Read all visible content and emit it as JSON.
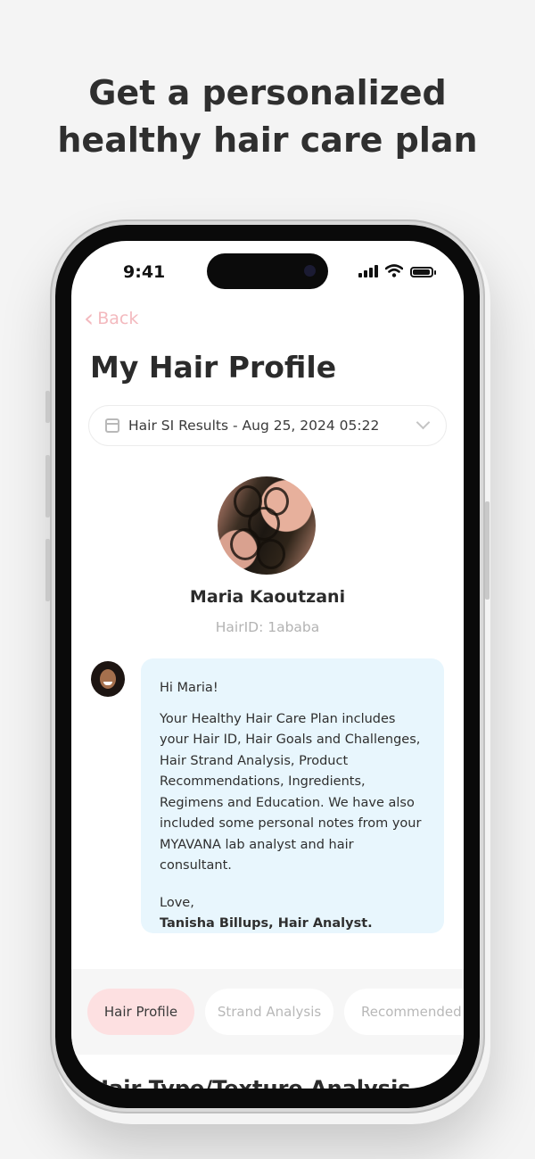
{
  "headline": {
    "line1": "Get a personalized",
    "line2": "healthy hair care plan"
  },
  "status_bar": {
    "time": "9:41"
  },
  "nav": {
    "back_label": "Back"
  },
  "page": {
    "title": "My Hair Profile"
  },
  "results_dropdown": {
    "selected": "Hair SI Results - Aug 25, 2024 05:22"
  },
  "profile": {
    "name": "Maria Kaoutzani",
    "hair_id": "HairID: 1ababa"
  },
  "message": {
    "greeting": "Hi Maria!",
    "body": "Your Healthy Hair Care Plan includes your Hair ID, Hair Goals and Challenges, Hair Strand Analysis, Product Recommendations, Ingredients, Regimens and Education. We have also included some personal notes from your MYAVANA lab analyst and hair consultant.",
    "closing": "Love,",
    "signature": "Tanisha Billups, Hair Analyst."
  },
  "tabs": [
    {
      "label": "Hair Profile",
      "active": true
    },
    {
      "label": "Strand Analysis",
      "active": false
    },
    {
      "label": "Recommended P",
      "active": false
    }
  ],
  "section": {
    "title_peek": "Hair Type/Texture Analysis"
  },
  "colors": {
    "accent_pink": "#fde0e1",
    "back_pink": "#f3b9be",
    "bubble_blue": "#e8f6fd"
  }
}
